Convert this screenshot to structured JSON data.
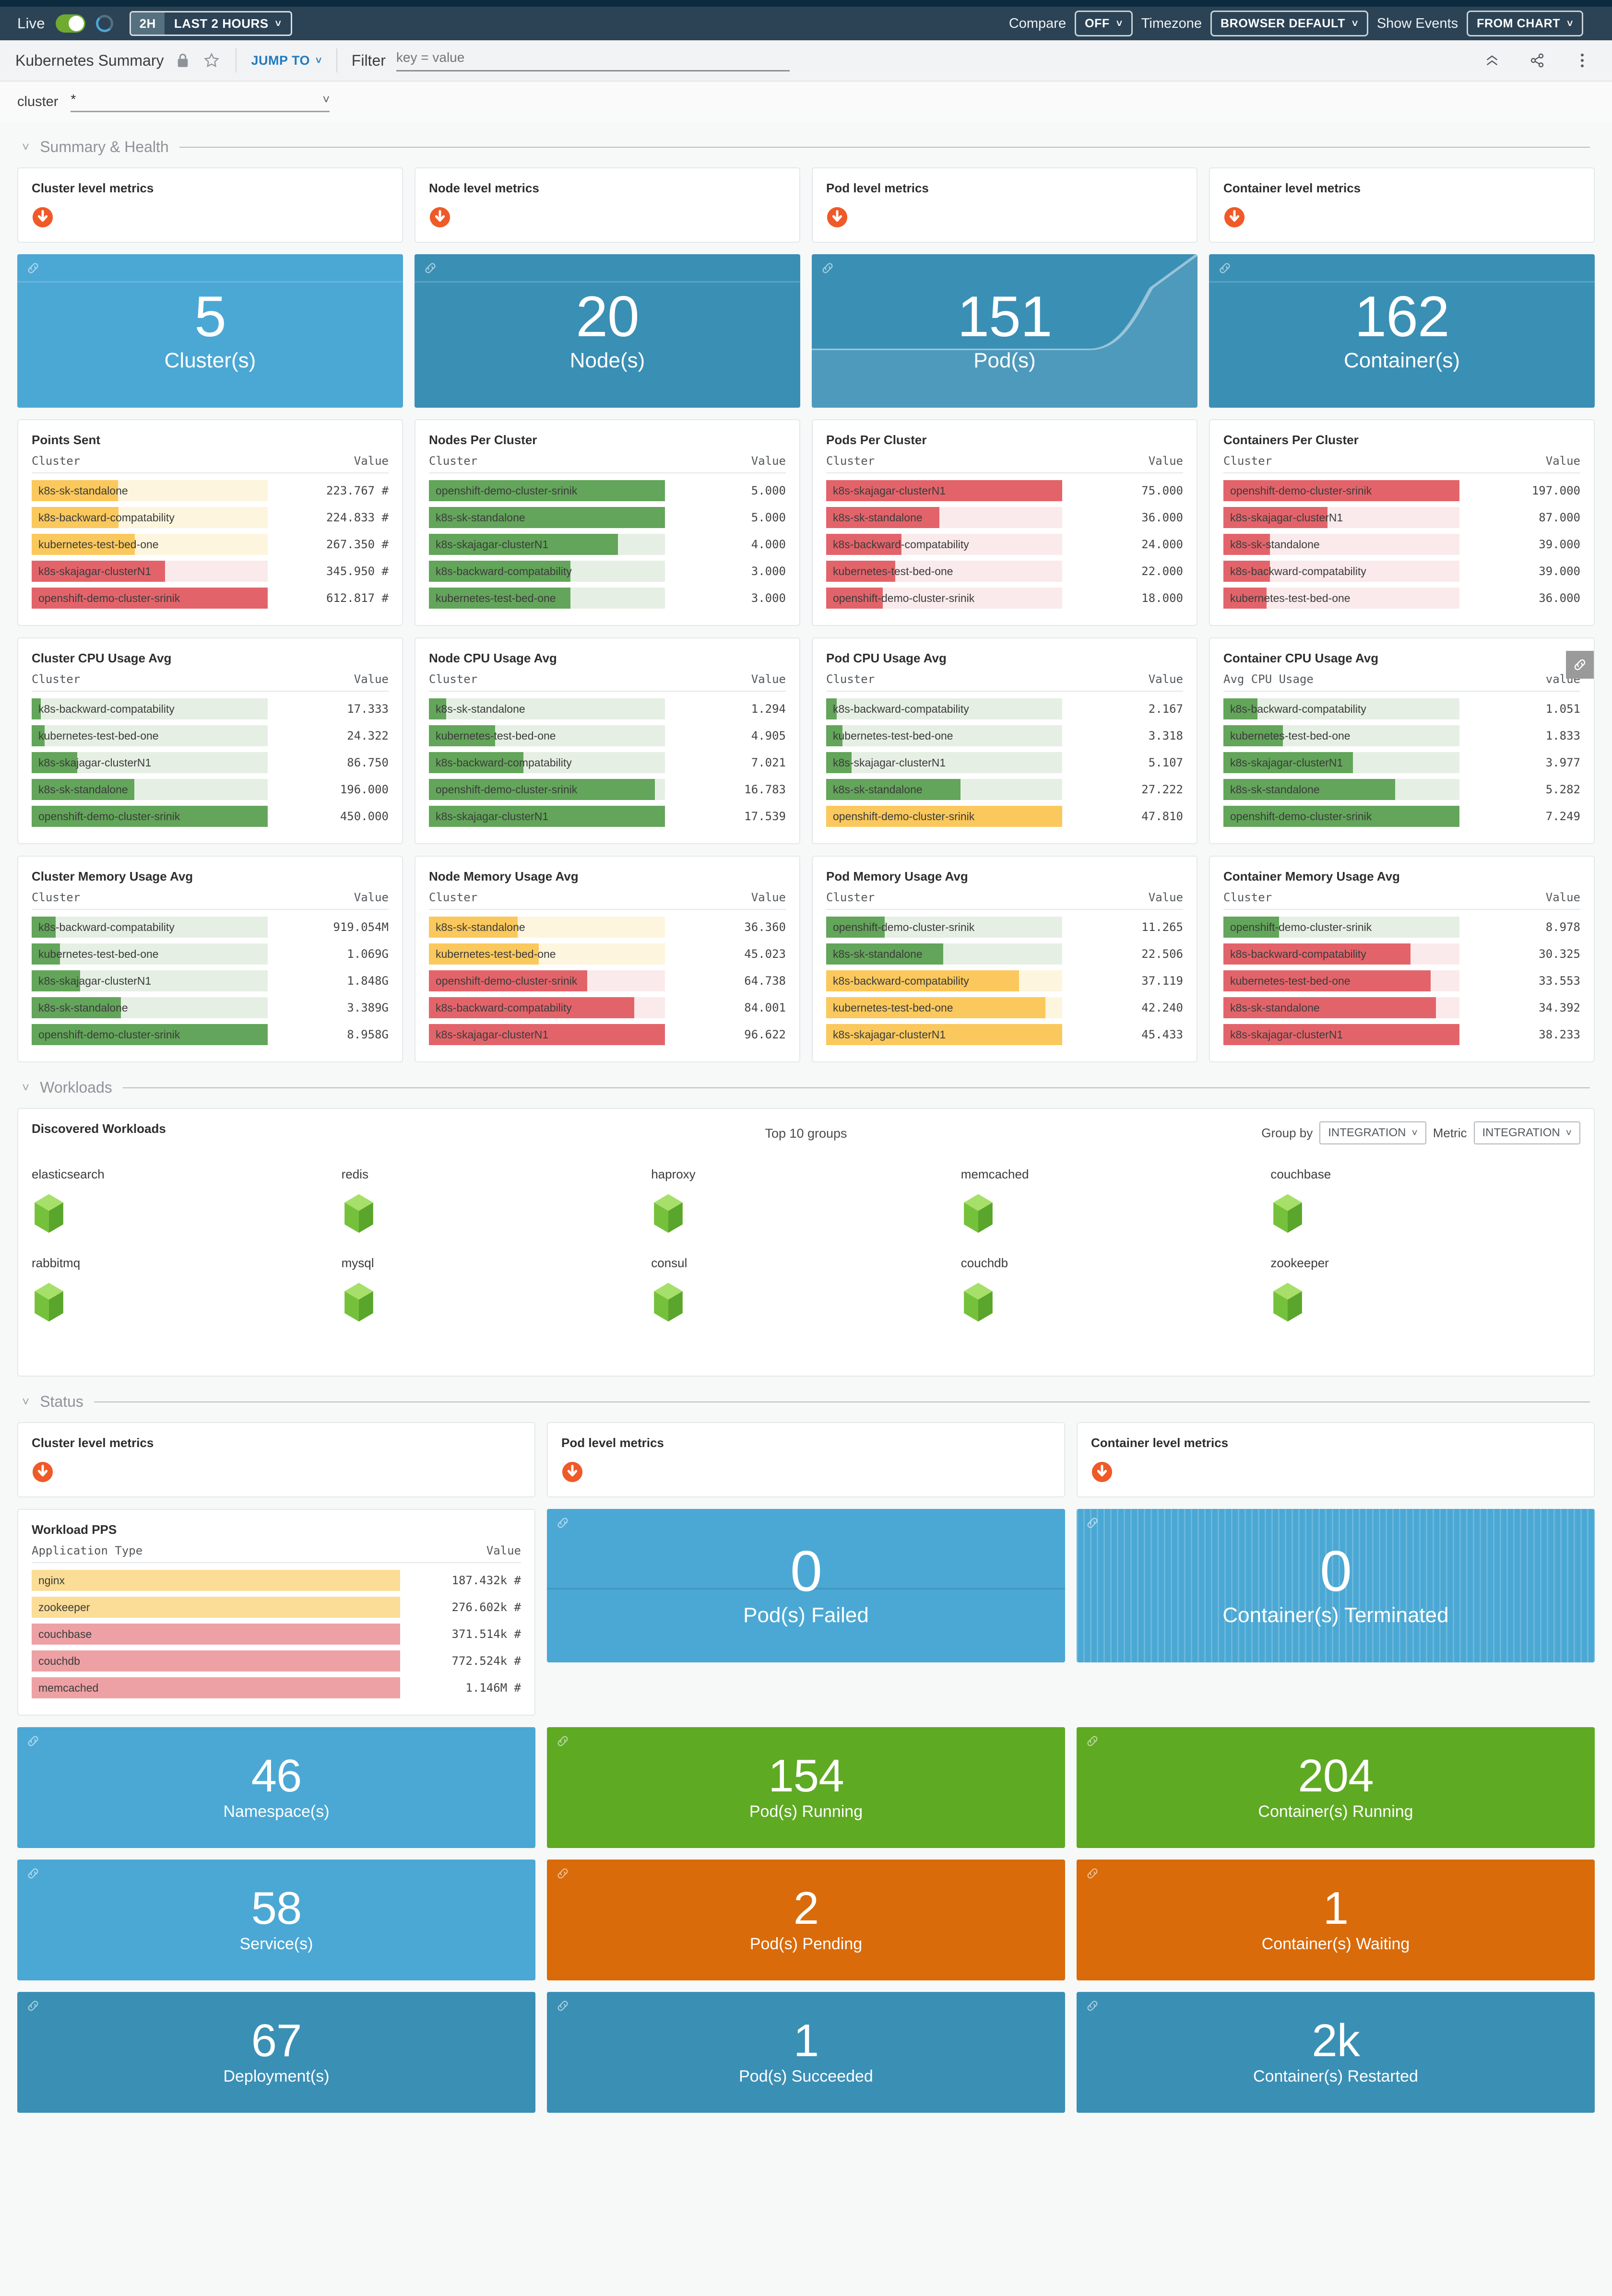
{
  "topbar": {
    "live_label": "Live",
    "live_on": true,
    "time_short": "2H",
    "time_range": "LAST 2 HOURS",
    "compare_label": "Compare",
    "compare_value": "OFF",
    "timezone_label": "Timezone",
    "timezone_value": "BROWSER DEFAULT",
    "show_events_label": "Show Events",
    "show_events_value": "FROM CHART"
  },
  "titlebar": {
    "title": "Kubernetes Summary",
    "lock_icon": "lock-icon",
    "star_icon": "star-icon",
    "jump_to": "JUMP TO",
    "filter_label": "Filter",
    "filter_placeholder": "key = value",
    "filter_value": "",
    "collapse_icon": "chevrons-up-icon",
    "share_icon": "share-icon",
    "more_icon": "kebab-menu-icon"
  },
  "variables": {
    "name": "cluster",
    "value": "*"
  },
  "sections": {
    "summary": "Summary & Health",
    "workloads": "Workloads",
    "status": "Status"
  },
  "notes_summary": [
    {
      "title": "Cluster level metrics",
      "icon": "download-arrow-icon"
    },
    {
      "title": "Node level metrics",
      "icon": "download-arrow-icon"
    },
    {
      "title": "Pod level metrics",
      "icon": "download-arrow-icon"
    },
    {
      "title": "Container level metrics",
      "icon": "download-arrow-icon"
    }
  ],
  "notes_status": [
    {
      "title": "Cluster level metrics",
      "icon": "download-arrow-icon"
    },
    {
      "title": "Pod level metrics",
      "icon": "download-arrow-icon"
    },
    {
      "title": "Container level metrics",
      "icon": "download-arrow-icon"
    }
  ],
  "summary_tiles": [
    {
      "value": "5",
      "label": "Cluster(s)",
      "color": "#4ba8d4",
      "style": "blue",
      "spark": "flat"
    },
    {
      "value": "20",
      "label": "Node(s)",
      "color": "#3a8fb5",
      "style": "blued",
      "spark": "flat"
    },
    {
      "value": "151",
      "label": "Pod(s)",
      "color": "#3a8fb5",
      "style": "blued",
      "spark": "curve"
    },
    {
      "value": "162",
      "label": "Container(s)",
      "color": "#3a8fb5",
      "style": "blued",
      "spark": "flat"
    }
  ],
  "status_tiles_big": [
    {
      "value": "0",
      "label": "Pod(s) Failed",
      "style": "blue",
      "spark": "split"
    },
    {
      "value": "0",
      "label": "Container(s) Terminated",
      "style": "blue",
      "spark": "stripes"
    }
  ],
  "status_tiles": [
    {
      "value": "46",
      "label": "Namespace(s)",
      "style": "blue"
    },
    {
      "value": "154",
      "label": "Pod(s) Running",
      "style": "green"
    },
    {
      "value": "204",
      "label": "Container(s) Running",
      "style": "green"
    },
    {
      "value": "58",
      "label": "Service(s)",
      "style": "blue"
    },
    {
      "value": "2",
      "label": "Pod(s) Pending",
      "style": "orange"
    },
    {
      "value": "1",
      "label": "Container(s) Waiting",
      "style": "orange"
    },
    {
      "value": "67",
      "label": "Deployment(s)",
      "style": "blued"
    },
    {
      "value": "1",
      "label": "Pod(s) Succeeded",
      "style": "blued"
    },
    {
      "value": "2k",
      "label": "Container(s) Restarted",
      "style": "blued"
    }
  ],
  "chart_data": [
    {
      "type": "bar",
      "title": "Points Sent",
      "xlabel": "Cluster",
      "ylabel": "Value",
      "unit": "#",
      "max": 612.817,
      "categories": [
        "k8s-sk-standalone",
        "k8s-backward-compatability",
        "kubernetes-test-bed-one",
        "k8s-skajagar-clusterN1",
        "openshift-demo-cluster-srinik"
      ],
      "values": [
        223.767,
        224.833,
        267.35,
        345.95,
        612.817
      ],
      "value_labels": [
        "223.767 #",
        "224.833 #",
        "267.350 #",
        "345.950 #",
        "612.817 #"
      ],
      "colors": [
        "#fac85c",
        "#fac85c",
        "#fac85c",
        "#e2646a",
        "#e2646a"
      ],
      "track_colors": [
        "#fdf5dd",
        "#fdf5dd",
        "#fdf5dd",
        "#fbeaeb",
        "#fbeaeb"
      ]
    },
    {
      "type": "bar",
      "title": "Nodes Per Cluster",
      "xlabel": "Cluster",
      "ylabel": "Value",
      "max": 5,
      "categories": [
        "openshift-demo-cluster-srinik",
        "k8s-sk-standalone",
        "k8s-skajagar-clusterN1",
        "k8s-backward-compatability",
        "kubernetes-test-bed-one"
      ],
      "values": [
        5.0,
        5.0,
        4.0,
        3.0,
        3.0
      ],
      "value_labels": [
        "5.000",
        "5.000",
        "4.000",
        "3.000",
        "3.000"
      ],
      "colors": [
        "#63a55a",
        "#63a55a",
        "#63a55a",
        "#63a55a",
        "#63a55a"
      ],
      "track_colors": [
        "#e6efe4",
        "#e6efe4",
        "#e6efe4",
        "#e6efe4",
        "#e6efe4"
      ]
    },
    {
      "type": "bar",
      "title": "Pods Per Cluster",
      "xlabel": "Cluster",
      "ylabel": "Value",
      "max": 75,
      "categories": [
        "k8s-skajagar-clusterN1",
        "k8s-sk-standalone",
        "k8s-backward-compatability",
        "kubernetes-test-bed-one",
        "openshift-demo-cluster-srinik"
      ],
      "values": [
        75.0,
        36.0,
        24.0,
        22.0,
        18.0
      ],
      "value_labels": [
        "75.000",
        "36.000",
        "24.000",
        "22.000",
        "18.000"
      ],
      "colors": [
        "#e2646a",
        "#e2646a",
        "#e2646a",
        "#e2646a",
        "#e2646a"
      ],
      "track_colors": [
        "#fbeaeb",
        "#fbeaeb",
        "#fbeaeb",
        "#fbeaeb",
        "#fbeaeb"
      ]
    },
    {
      "type": "bar",
      "title": "Containers Per Cluster",
      "xlabel": "Cluster",
      "ylabel": "Value",
      "max": 197,
      "categories": [
        "openshift-demo-cluster-srinik",
        "k8s-skajagar-clusterN1",
        "k8s-sk-standalone",
        "k8s-backward-compatability",
        "kubernetes-test-bed-one"
      ],
      "values": [
        197.0,
        87.0,
        39.0,
        39.0,
        36.0
      ],
      "value_labels": [
        "197.000",
        "87.000",
        "39.000",
        "39.000",
        "36.000"
      ],
      "colors": [
        "#e2646a",
        "#e2646a",
        "#e2646a",
        "#e2646a",
        "#e2646a"
      ],
      "track_colors": [
        "#fbeaeb",
        "#fbeaeb",
        "#fbeaeb",
        "#fbeaeb",
        "#fbeaeb"
      ]
    },
    {
      "type": "bar",
      "title": "Cluster CPU Usage Avg",
      "xlabel": "Cluster",
      "ylabel": "Value",
      "max": 450,
      "categories": [
        "k8s-backward-compatability",
        "kubernetes-test-bed-one",
        "k8s-skajagar-clusterN1",
        "k8s-sk-standalone",
        "openshift-demo-cluster-srinik"
      ],
      "values": [
        17.333,
        24.322,
        86.75,
        196.0,
        450.0
      ],
      "value_labels": [
        "17.333",
        "24.322",
        "86.750",
        "196.000",
        "450.000"
      ],
      "colors": [
        "#63a55a",
        "#63a55a",
        "#63a55a",
        "#63a55a",
        "#63a55a"
      ],
      "track_colors": [
        "#e6efe4",
        "#e6efe4",
        "#e6efe4",
        "#e6efe4",
        "#e6efe4"
      ]
    },
    {
      "type": "bar",
      "title": "Node CPU Usage Avg",
      "xlabel": "Cluster",
      "ylabel": "Value",
      "max": 17.539,
      "categories": [
        "k8s-sk-standalone",
        "kubernetes-test-bed-one",
        "k8s-backward-compatability",
        "openshift-demo-cluster-srinik",
        "k8s-skajagar-clusterN1"
      ],
      "values": [
        1.294,
        4.905,
        7.021,
        16.783,
        17.539
      ],
      "value_labels": [
        "1.294",
        "4.905",
        "7.021",
        "16.783",
        "17.539"
      ],
      "colors": [
        "#63a55a",
        "#63a55a",
        "#63a55a",
        "#63a55a",
        "#63a55a"
      ],
      "track_colors": [
        "#e6efe4",
        "#e6efe4",
        "#e6efe4",
        "#e6efe4",
        "#e6efe4"
      ]
    },
    {
      "type": "bar",
      "title": "Pod CPU Usage Avg",
      "xlabel": "Cluster",
      "ylabel": "Value",
      "max": 47.81,
      "categories": [
        "k8s-backward-compatability",
        "kubernetes-test-bed-one",
        "k8s-skajagar-clusterN1",
        "k8s-sk-standalone",
        "openshift-demo-cluster-srinik"
      ],
      "values": [
        2.167,
        3.318,
        5.107,
        27.222,
        47.81
      ],
      "value_labels": [
        "2.167",
        "3.318",
        "5.107",
        "27.222",
        "47.810"
      ],
      "colors": [
        "#63a55a",
        "#63a55a",
        "#63a55a",
        "#63a55a",
        "#fac85c"
      ],
      "track_colors": [
        "#e6efe4",
        "#e6efe4",
        "#e6efe4",
        "#e6efe4",
        "#fdf5dd"
      ]
    },
    {
      "type": "bar",
      "title": "Container CPU Usage Avg",
      "xlabel": "Avg CPU Usage",
      "ylabel": "value",
      "max": 7.249,
      "categories": [
        "k8s-backward-compatability",
        "kubernetes-test-bed-one",
        "k8s-skajagar-clusterN1",
        "k8s-sk-standalone",
        "openshift-demo-cluster-srinik"
      ],
      "values": [
        1.051,
        1.833,
        3.977,
        5.282,
        7.249
      ],
      "value_labels": [
        "1.051",
        "1.833",
        "3.977",
        "5.282",
        "7.249"
      ],
      "colors": [
        "#63a55a",
        "#63a55a",
        "#63a55a",
        "#63a55a",
        "#63a55a"
      ],
      "track_colors": [
        "#e6efe4",
        "#e6efe4",
        "#e6efe4",
        "#e6efe4",
        "#e6efe4"
      ]
    },
    {
      "type": "bar",
      "title": "Cluster Memory Usage Avg",
      "xlabel": "Cluster",
      "ylabel": "Value",
      "max": 8.958,
      "categories": [
        "k8s-backward-compatability",
        "kubernetes-test-bed-one",
        "k8s-skajagar-clusterN1",
        "k8s-sk-standalone",
        "openshift-demo-cluster-srinik"
      ],
      "values": [
        0.919054,
        1.069,
        1.848,
        3.389,
        8.958
      ],
      "value_labels": [
        "919.054M",
        "1.069G",
        "1.848G",
        "3.389G",
        "8.958G"
      ],
      "colors": [
        "#63a55a",
        "#63a55a",
        "#63a55a",
        "#63a55a",
        "#63a55a"
      ],
      "track_colors": [
        "#e6efe4",
        "#e6efe4",
        "#e6efe4",
        "#e6efe4",
        "#e6efe4"
      ]
    },
    {
      "type": "bar",
      "title": "Node Memory Usage Avg",
      "xlabel": "Cluster",
      "ylabel": "Value",
      "max": 96.622,
      "categories": [
        "k8s-sk-standalone",
        "kubernetes-test-bed-one",
        "openshift-demo-cluster-srinik",
        "k8s-backward-compatability",
        "k8s-skajagar-clusterN1"
      ],
      "values": [
        36.36,
        45.023,
        64.738,
        84.001,
        96.622
      ],
      "value_labels": [
        "36.360",
        "45.023",
        "64.738",
        "84.001",
        "96.622"
      ],
      "colors": [
        "#fac85c",
        "#fac85c",
        "#e2646a",
        "#e2646a",
        "#e2646a"
      ],
      "track_colors": [
        "#fdf5dd",
        "#fdf5dd",
        "#fbeaeb",
        "#fbeaeb",
        "#fbeaeb"
      ]
    },
    {
      "type": "bar",
      "title": "Pod Memory Usage Avg",
      "xlabel": "Cluster",
      "ylabel": "Value",
      "max": 45.433,
      "categories": [
        "openshift-demo-cluster-srinik",
        "k8s-sk-standalone",
        "k8s-backward-compatability",
        "kubernetes-test-bed-one",
        "k8s-skajagar-clusterN1"
      ],
      "values": [
        11.265,
        22.506,
        37.119,
        42.24,
        45.433
      ],
      "value_labels": [
        "11.265",
        "22.506",
        "37.119",
        "42.240",
        "45.433"
      ],
      "colors": [
        "#63a55a",
        "#63a55a",
        "#fac85c",
        "#fac85c",
        "#fac85c"
      ],
      "track_colors": [
        "#e6efe4",
        "#e6efe4",
        "#fdf5dd",
        "#fdf5dd",
        "#fdf5dd"
      ]
    },
    {
      "type": "bar",
      "title": "Container Memory Usage Avg",
      "xlabel": "Cluster",
      "ylabel": "Value",
      "max": 38.233,
      "categories": [
        "openshift-demo-cluster-srinik",
        "k8s-backward-compatability",
        "kubernetes-test-bed-one",
        "k8s-sk-standalone",
        "k8s-skajagar-clusterN1"
      ],
      "values": [
        8.978,
        30.325,
        33.553,
        34.392,
        38.233
      ],
      "value_labels": [
        "8.978",
        "30.325",
        "33.553",
        "34.392",
        "38.233"
      ],
      "colors": [
        "#63a55a",
        "#e2646a",
        "#e2646a",
        "#e2646a",
        "#e2646a"
      ],
      "track_colors": [
        "#e6efe4",
        "#fbeaeb",
        "#fbeaeb",
        "#fbeaeb",
        "#fbeaeb"
      ]
    },
    {
      "type": "bar",
      "title": "Workload PPS",
      "xlabel": "Application Type",
      "ylabel": "Value",
      "unit": "#",
      "max": 1.146,
      "categories": [
        "nginx",
        "zookeeper",
        "couchbase",
        "couchdb",
        "memcached"
      ],
      "values": [
        0.187432,
        0.276602,
        0.371514,
        0.772524,
        1.146
      ],
      "value_labels": [
        "187.432k #",
        "276.602k #",
        "371.514k #",
        "772.524k #",
        "1.146M #"
      ],
      "colors": [
        "#fac85c",
        "#fac85c",
        "#e2646a",
        "#e2646a",
        "#e2646a"
      ],
      "track_colors": [
        "#fdf5dd",
        "#fdf5dd",
        "#fbeaeb",
        "#fbeaeb",
        "#fbeaeb"
      ],
      "full_track": true
    }
  ],
  "workloads": {
    "title": "Discovered Workloads",
    "top_label": "Top 10 groups",
    "group_by_label": "Group by",
    "group_by_value": "INTEGRATION",
    "metric_label": "Metric",
    "metric_value": "INTEGRATION",
    "items": [
      {
        "name": "elasticsearch",
        "icon": "cube-icon"
      },
      {
        "name": "redis",
        "icon": "cube-icon"
      },
      {
        "name": "haproxy",
        "icon": "cube-icon"
      },
      {
        "name": "memcached",
        "icon": "cube-icon"
      },
      {
        "name": "couchbase",
        "icon": "cube-icon"
      },
      {
        "name": "rabbitmq",
        "icon": "cube-icon"
      },
      {
        "name": "mysql",
        "icon": "cube-icon"
      },
      {
        "name": "consul",
        "icon": "cube-icon"
      },
      {
        "name": "couchdb",
        "icon": "cube-icon"
      },
      {
        "name": "zookeeper",
        "icon": "cube-icon"
      }
    ]
  }
}
